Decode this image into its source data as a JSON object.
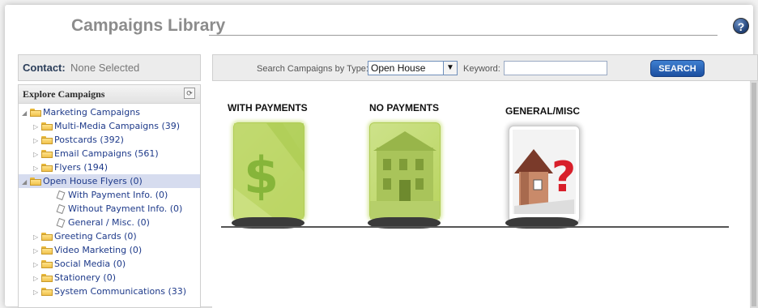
{
  "page": {
    "title": "Campaigns Library",
    "help_icon": "help-icon"
  },
  "contact": {
    "label": "Contact:",
    "value": "None Selected"
  },
  "explore": {
    "header": "Explore Campaigns",
    "refresh_icon": "refresh-icon",
    "tree": [
      {
        "label": "Marketing Campaigns",
        "level": 0,
        "expanded": true,
        "type": "folder"
      },
      {
        "label": "Multi-Media Campaigns (39)",
        "level": 1,
        "expanded": false,
        "type": "folder"
      },
      {
        "label": "Postcards (392)",
        "level": 1,
        "expanded": false,
        "type": "folder"
      },
      {
        "label": "Email Campaigns (561)",
        "level": 1,
        "expanded": false,
        "type": "folder"
      },
      {
        "label": "Flyers (194)",
        "level": 1,
        "expanded": false,
        "type": "folder"
      },
      {
        "label": "Open House Flyers (0)",
        "level": 1,
        "expanded": true,
        "type": "folder",
        "selected": true
      },
      {
        "label": "With Payment Info. (0)",
        "level": 2,
        "type": "doc"
      },
      {
        "label": "Without Payment Info. (0)",
        "level": 2,
        "type": "doc"
      },
      {
        "label": "General / Misc. (0)",
        "level": 2,
        "type": "doc"
      },
      {
        "label": "Greeting Cards (0)",
        "level": 1,
        "expanded": false,
        "type": "folder"
      },
      {
        "label": "Video Marketing (0)",
        "level": 1,
        "expanded": false,
        "type": "folder"
      },
      {
        "label": "Social Media (0)",
        "level": 1,
        "expanded": false,
        "type": "folder"
      },
      {
        "label": "Stationery (0)",
        "level": 1,
        "expanded": false,
        "type": "folder"
      },
      {
        "label": "System Communications (33)",
        "level": 1,
        "expanded": false,
        "type": "folder"
      }
    ]
  },
  "search": {
    "type_label": "Search Campaigns by Type:",
    "type_value": "Open House",
    "keyword_label": "Keyword:",
    "keyword_value": "",
    "button": "SEARCH"
  },
  "categories": [
    {
      "label": "WITH PAYMENTS",
      "icon": "dollar-sign-thumbnail",
      "symbol": "$"
    },
    {
      "label": "NO PAYMENTS",
      "icon": "house-photo-thumbnail"
    },
    {
      "label": "GENERAL/MISC",
      "icon": "house-question-thumbnail"
    }
  ],
  "colors": {
    "title": "#8c8c8c",
    "search_button": "#1b4fa0",
    "tree_text": "#1e3a8a",
    "selected_row": "#d6dcef",
    "green_card": "#c4dc72"
  }
}
